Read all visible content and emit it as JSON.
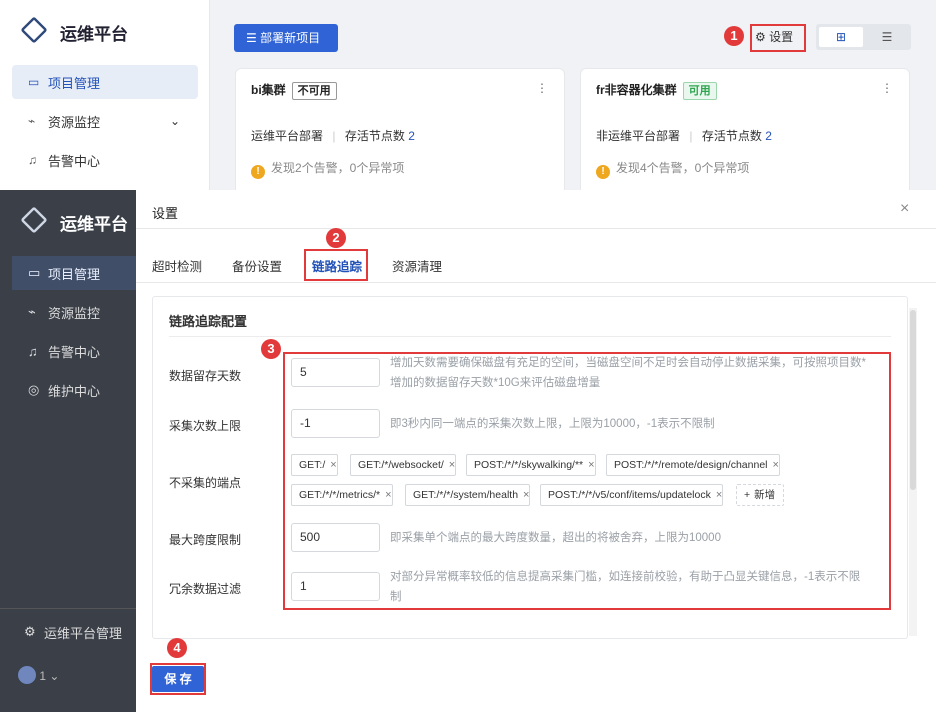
{
  "app": {
    "title": "运维平台"
  },
  "sidebar": {
    "items": [
      {
        "label": "项目管理",
        "icon": "project-icon"
      },
      {
        "label": "资源监控",
        "icon": "monitor-icon"
      },
      {
        "label": "告警中心",
        "icon": "alarm-icon"
      },
      {
        "label": "维护中心",
        "icon": "maintenance-icon"
      }
    ],
    "footer_label": "运维平台管理",
    "user_label": "1"
  },
  "toolbar": {
    "deploy_label": "部署新项目",
    "settings_label": "设置"
  },
  "cards": [
    {
      "name": "bi集群",
      "badge": "不可用",
      "desc": "运维平台部署",
      "nodes_label": "存活节点数",
      "nodes": "2",
      "alert": "发现2个告警，0个异常项"
    },
    {
      "name": "fr非容器化集群",
      "badge": "可用",
      "desc": "非运维平台部署",
      "nodes_label": "存活节点数",
      "nodes": "2",
      "alert": "发现4个告警，0个异常项"
    }
  ],
  "modal": {
    "title": "设置",
    "tabs": [
      "超时检测",
      "备份设置",
      "链路追踪",
      "资源清理"
    ],
    "section_title": "链路追踪配置",
    "fields": {
      "retention": {
        "label": "数据留存天数",
        "value": "5",
        "hint1": "增加天数需要确保磁盘有充足的空间，当磁盘空间不足时会自动停止数据采集，可按照项目数*",
        "hint2": "增加的数据留存天数*10G来评估磁盘增量"
      },
      "limit": {
        "label": "采集次数上限",
        "value": "-1",
        "hint": "即3秒内同一端点的采集次数上限，上限为10000，-1表示不限制"
      },
      "excluded": {
        "label": "不采集的端点",
        "tags": [
          "GET:/",
          "GET:/*/websocket/",
          "POST:/*/*/skywalking/**",
          "POST:/*/*/remote/design/channel",
          "GET:/*/*/metrics/*",
          "GET:/*/*/system/health",
          "POST:/*/*/v5/conf/items/updatelock"
        ],
        "add_label": "新增"
      },
      "span": {
        "label": "最大跨度限制",
        "value": "500",
        "hint": "即采集单个端点的最大跨度数量，超出的将被舍弃，上限为10000"
      },
      "filter": {
        "label": "冗余数据过滤",
        "value": "1",
        "hint1": "对部分异常概率较低的信息提高采集门槛，如连接前校验，有助于凸显关键信息，-1表示不限",
        "hint2": "制"
      }
    },
    "save_label": "保 存"
  },
  "markers": [
    "1",
    "2",
    "3",
    "4"
  ],
  "colors": {
    "accent": "#2352b8",
    "highlight": "#e23a3a",
    "ok": "#2ea44f"
  }
}
